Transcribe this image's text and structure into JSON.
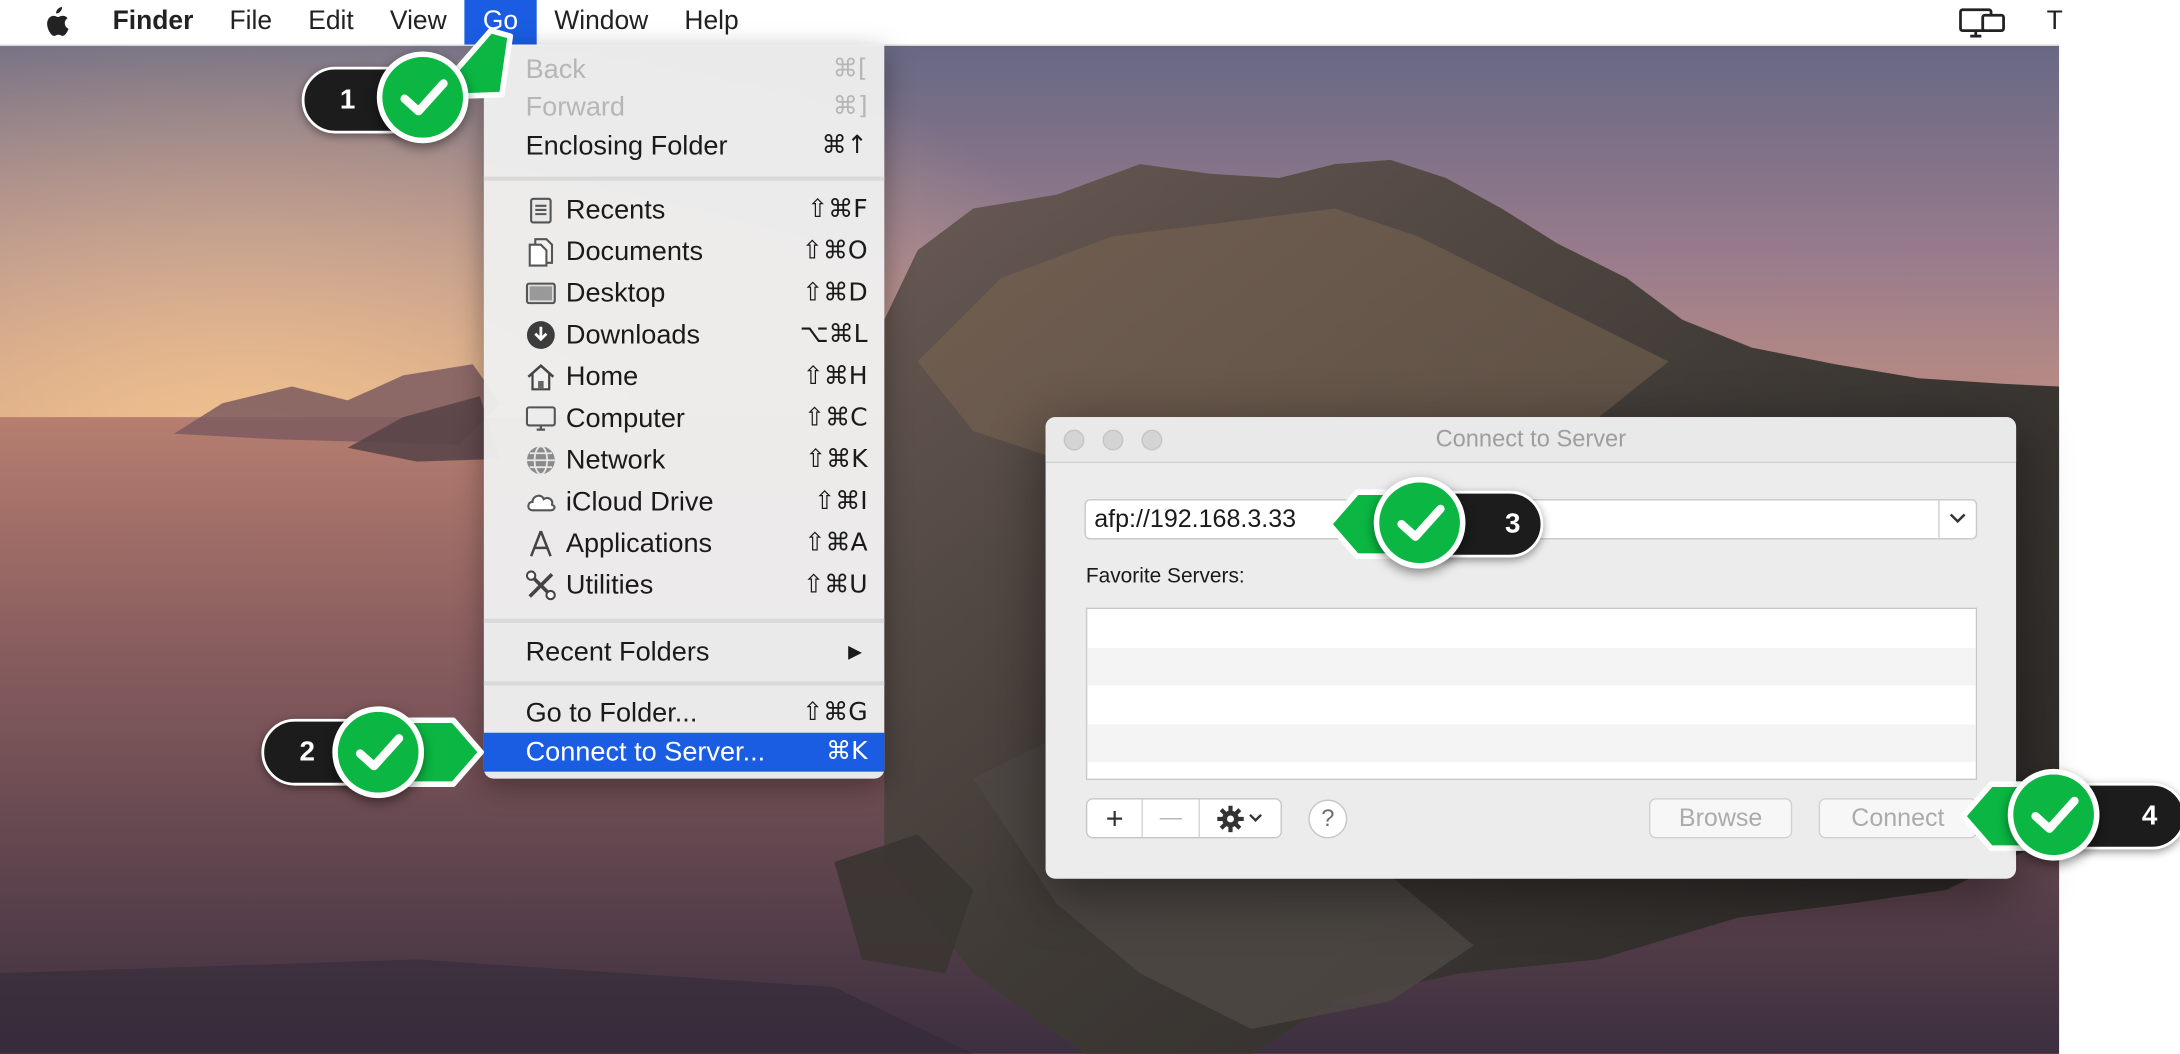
{
  "menu_bar": {
    "app_name": "Finder",
    "items": [
      "File",
      "Edit",
      "View",
      "Go",
      "Window",
      "Help"
    ],
    "active_item": "Go",
    "right_partial_text": "T"
  },
  "go_menu": {
    "back": {
      "label": "Back",
      "shortcut": "⌘[",
      "enabled": false
    },
    "forward": {
      "label": "Forward",
      "shortcut": "⌘]",
      "enabled": false
    },
    "enclosing": {
      "label": "Enclosing Folder",
      "shortcut": "⌘↑"
    },
    "locations": [
      {
        "label": "Recents",
        "shortcut": "⇧⌘F",
        "icon": "recents-icon"
      },
      {
        "label": "Documents",
        "shortcut": "⇧⌘O",
        "icon": "documents-icon"
      },
      {
        "label": "Desktop",
        "shortcut": "⇧⌘D",
        "icon": "desktop-icon"
      },
      {
        "label": "Downloads",
        "shortcut": "⌥⌘L",
        "icon": "downloads-icon"
      },
      {
        "label": "Home",
        "shortcut": "⇧⌘H",
        "icon": "home-icon"
      },
      {
        "label": "Computer",
        "shortcut": "⇧⌘C",
        "icon": "computer-icon"
      },
      {
        "label": "Network",
        "shortcut": "⇧⌘K",
        "icon": "network-icon"
      },
      {
        "label": "iCloud Drive",
        "shortcut": "⇧⌘I",
        "icon": "icloud-icon"
      },
      {
        "label": "Applications",
        "shortcut": "⇧⌘A",
        "icon": "applications-icon"
      },
      {
        "label": "Utilities",
        "shortcut": "⇧⌘U",
        "icon": "utilities-icon"
      }
    ],
    "recent_folders": {
      "label": "Recent Folders",
      "arrow": "▶"
    },
    "go_to_folder": {
      "label": "Go to Folder...",
      "shortcut": "⇧⌘G"
    },
    "connect_to_server": {
      "label": "Connect to Server...",
      "shortcut": "⌘K",
      "selected": true
    }
  },
  "dialog": {
    "title": "Connect to Server",
    "server_address": "afp://192.168.3.33",
    "favorites_label": "Favorite Servers:",
    "favorite_servers": [],
    "add_label": "+",
    "remove_label": "—",
    "help_label": "?",
    "browse_label": "Browse",
    "connect_label": "Connect"
  },
  "annotations": [
    {
      "number": "1",
      "target": "Go menu"
    },
    {
      "number": "2",
      "target": "Connect to Server..."
    },
    {
      "number": "3",
      "target": "server address field"
    },
    {
      "number": "4",
      "target": "Connect button"
    }
  ],
  "colors": {
    "menu_highlight": "#1a5de2",
    "annotation_green": "#0bb742",
    "annotation_dark": "#1c1c1c"
  }
}
